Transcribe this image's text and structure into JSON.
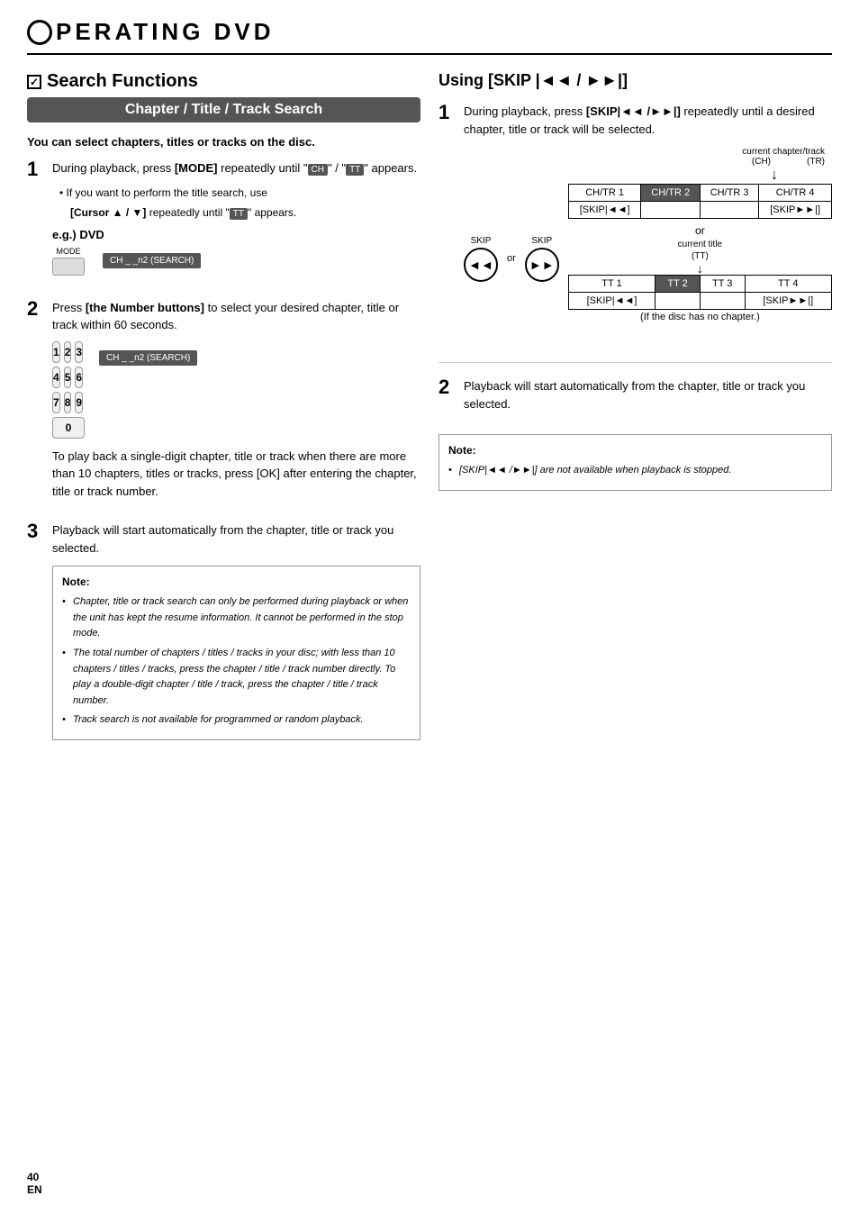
{
  "header": {
    "title": "PERATING   DVD"
  },
  "left": {
    "section_title": "Search Functions",
    "chapter_banner": "Chapter / Title / Track Search",
    "intro": "You can select chapters, titles or tracks on the disc.",
    "steps": [
      {
        "number": "1",
        "text_html": "During playback, press <b>[MODE]</b> repeatedly until \"<span class='small-badge'>CH</span>\" / \"<span class='small-badge'>TT</span>\" appears.",
        "sub1": "• If you want to perform the title search, use",
        "sub2": "  [Cursor ▲ / ▼] repeatedly until \"<span class='small-badge'>TT</span>\" appears.",
        "eg_label": "e.g.) DVD",
        "remote_btn": "MODE",
        "display_text": "CH _ _n2 (SEARCH)"
      },
      {
        "number": "2",
        "text_html": "Press <b>[the Number buttons]</b> to select your desired chapter, title or track within 60 seconds.",
        "display_text": "CH _ _n2 (SEARCH)",
        "numpad": [
          "1",
          "2",
          "3",
          "4",
          "5",
          "6",
          "7",
          "8",
          "9",
          "0"
        ]
      },
      {
        "number": "3",
        "text_html": "Playback will start automatically from the chapter, title or track you selected."
      }
    ],
    "between_step2_text": "To play back a single-digit chapter, title or track when there are more than 10 chapters, titles or tracks, press [OK] after entering the chapter, title or track number.",
    "note_title": "Note:",
    "note_bullets": [
      "Chapter, title or track search can only be performed during playback or when the unit has kept the resume information. It cannot be performed in the stop mode.",
      "The total number of chapters / titles / tracks in your disc; with less than 10 chapters / titles / tracks, press the chapter / title / track number directly. To play a double-digit chapter / title / track, press the chapter / title / track number.",
      "Track search is not available for programmed or random playback."
    ]
  },
  "right": {
    "section_title": "Using [SKIP |◄◄ / ►►|]",
    "step1": {
      "number": "1",
      "text_html": "During playback, press <b>[SKIP|◄◄ /►►|]</b> repeatedly until a desired chapter, title or track will be selected.",
      "current_ch_label": "current chapter/track",
      "ch_label": "(CH)",
      "tr_label": "(TR)",
      "skip_back_label": "SKIP",
      "skip_fwd_label": "SKIP",
      "or_text": "or",
      "ch_tr_table": {
        "rows": [
          [
            "CH/TR 1",
            "CH/TR 2",
            "CH/TR 3",
            "CH/TR 4"
          ],
          [
            "[SKIP|◄◄]",
            "",
            "",
            "[SKIP►►|]"
          ]
        ],
        "highlighted_col": 1
      },
      "or_center": "or",
      "current_title_label": "current title",
      "tt_label": "(TT)",
      "tt_table": {
        "rows": [
          [
            "TT 1",
            "TT 2",
            "TT 3",
            "TT 4"
          ],
          [
            "[SKIP|◄◄]",
            "",
            "",
            "[SKIP►►|]"
          ]
        ],
        "highlighted_col": 1
      },
      "no_chapter": "(If the disc has no chapter.)"
    },
    "step2": {
      "number": "2",
      "text": "Playback will start automatically from the chapter, title or track you selected."
    },
    "note_title": "Note:",
    "note_bullets": [
      "[SKIP|◄◄ /►►|] are not available when playback is stopped."
    ]
  },
  "footer": {
    "page_number": "40",
    "lang": "EN"
  }
}
